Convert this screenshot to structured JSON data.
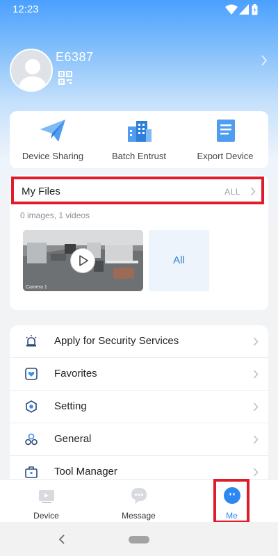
{
  "status_bar": {
    "time": "12:23"
  },
  "profile": {
    "username": "E6387"
  },
  "actions": [
    {
      "label": "Device Sharing",
      "icon": "paper-plane-icon"
    },
    {
      "label": "Batch Entrust",
      "icon": "building-icon"
    },
    {
      "label": "Export Device",
      "icon": "document-icon"
    }
  ],
  "files": {
    "title": "My Files",
    "all_link": "ALL",
    "count": "0 images, 1 videos",
    "all_tile": "All",
    "thumb_caption": "Camera 1"
  },
  "menu": [
    {
      "label": "Apply for Security Services",
      "icon": "alarm-light-icon"
    },
    {
      "label": "Favorites",
      "icon": "favorites-heart-icon"
    },
    {
      "label": "Setting",
      "icon": "setting-hex-icon"
    },
    {
      "label": "General",
      "icon": "general-cubes-icon"
    },
    {
      "label": "Tool Manager",
      "icon": "toolbox-icon"
    }
  ],
  "tabs": [
    {
      "label": "Device",
      "icon": "video-camera-icon"
    },
    {
      "label": "Message",
      "icon": "chat-bubble-icon"
    },
    {
      "label": "Me",
      "icon": "me-face-icon"
    }
  ],
  "colors": {
    "accent": "#2d87f0",
    "highlight": "#e01c2a"
  }
}
